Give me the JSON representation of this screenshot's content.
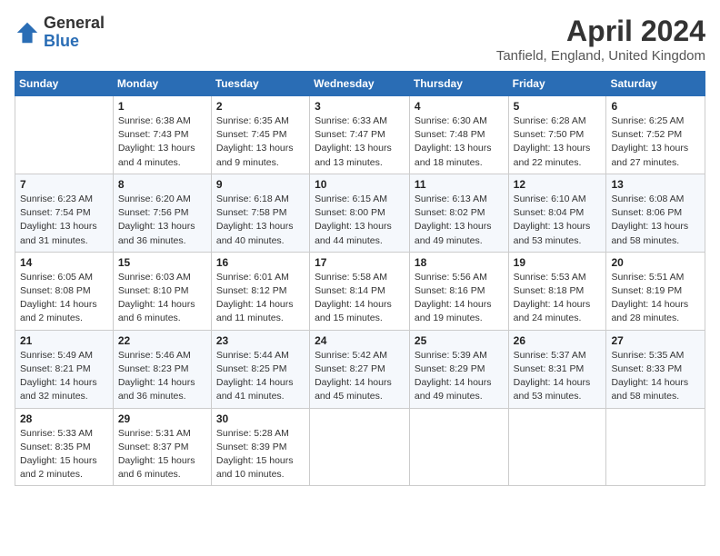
{
  "logo": {
    "general": "General",
    "blue": "Blue"
  },
  "title": "April 2024",
  "location": "Tanfield, England, United Kingdom",
  "days_of_week": [
    "Sunday",
    "Monday",
    "Tuesday",
    "Wednesday",
    "Thursday",
    "Friday",
    "Saturday"
  ],
  "weeks": [
    [
      {
        "day": "",
        "info": ""
      },
      {
        "day": "1",
        "info": "Sunrise: 6:38 AM\nSunset: 7:43 PM\nDaylight: 13 hours\nand 4 minutes."
      },
      {
        "day": "2",
        "info": "Sunrise: 6:35 AM\nSunset: 7:45 PM\nDaylight: 13 hours\nand 9 minutes."
      },
      {
        "day": "3",
        "info": "Sunrise: 6:33 AM\nSunset: 7:47 PM\nDaylight: 13 hours\nand 13 minutes."
      },
      {
        "day": "4",
        "info": "Sunrise: 6:30 AM\nSunset: 7:48 PM\nDaylight: 13 hours\nand 18 minutes."
      },
      {
        "day": "5",
        "info": "Sunrise: 6:28 AM\nSunset: 7:50 PM\nDaylight: 13 hours\nand 22 minutes."
      },
      {
        "day": "6",
        "info": "Sunrise: 6:25 AM\nSunset: 7:52 PM\nDaylight: 13 hours\nand 27 minutes."
      }
    ],
    [
      {
        "day": "7",
        "info": "Sunrise: 6:23 AM\nSunset: 7:54 PM\nDaylight: 13 hours\nand 31 minutes."
      },
      {
        "day": "8",
        "info": "Sunrise: 6:20 AM\nSunset: 7:56 PM\nDaylight: 13 hours\nand 36 minutes."
      },
      {
        "day": "9",
        "info": "Sunrise: 6:18 AM\nSunset: 7:58 PM\nDaylight: 13 hours\nand 40 minutes."
      },
      {
        "day": "10",
        "info": "Sunrise: 6:15 AM\nSunset: 8:00 PM\nDaylight: 13 hours\nand 44 minutes."
      },
      {
        "day": "11",
        "info": "Sunrise: 6:13 AM\nSunset: 8:02 PM\nDaylight: 13 hours\nand 49 minutes."
      },
      {
        "day": "12",
        "info": "Sunrise: 6:10 AM\nSunset: 8:04 PM\nDaylight: 13 hours\nand 53 minutes."
      },
      {
        "day": "13",
        "info": "Sunrise: 6:08 AM\nSunset: 8:06 PM\nDaylight: 13 hours\nand 58 minutes."
      }
    ],
    [
      {
        "day": "14",
        "info": "Sunrise: 6:05 AM\nSunset: 8:08 PM\nDaylight: 14 hours\nand 2 minutes."
      },
      {
        "day": "15",
        "info": "Sunrise: 6:03 AM\nSunset: 8:10 PM\nDaylight: 14 hours\nand 6 minutes."
      },
      {
        "day": "16",
        "info": "Sunrise: 6:01 AM\nSunset: 8:12 PM\nDaylight: 14 hours\nand 11 minutes."
      },
      {
        "day": "17",
        "info": "Sunrise: 5:58 AM\nSunset: 8:14 PM\nDaylight: 14 hours\nand 15 minutes."
      },
      {
        "day": "18",
        "info": "Sunrise: 5:56 AM\nSunset: 8:16 PM\nDaylight: 14 hours\nand 19 minutes."
      },
      {
        "day": "19",
        "info": "Sunrise: 5:53 AM\nSunset: 8:18 PM\nDaylight: 14 hours\nand 24 minutes."
      },
      {
        "day": "20",
        "info": "Sunrise: 5:51 AM\nSunset: 8:19 PM\nDaylight: 14 hours\nand 28 minutes."
      }
    ],
    [
      {
        "day": "21",
        "info": "Sunrise: 5:49 AM\nSunset: 8:21 PM\nDaylight: 14 hours\nand 32 minutes."
      },
      {
        "day": "22",
        "info": "Sunrise: 5:46 AM\nSunset: 8:23 PM\nDaylight: 14 hours\nand 36 minutes."
      },
      {
        "day": "23",
        "info": "Sunrise: 5:44 AM\nSunset: 8:25 PM\nDaylight: 14 hours\nand 41 minutes."
      },
      {
        "day": "24",
        "info": "Sunrise: 5:42 AM\nSunset: 8:27 PM\nDaylight: 14 hours\nand 45 minutes."
      },
      {
        "day": "25",
        "info": "Sunrise: 5:39 AM\nSunset: 8:29 PM\nDaylight: 14 hours\nand 49 minutes."
      },
      {
        "day": "26",
        "info": "Sunrise: 5:37 AM\nSunset: 8:31 PM\nDaylight: 14 hours\nand 53 minutes."
      },
      {
        "day": "27",
        "info": "Sunrise: 5:35 AM\nSunset: 8:33 PM\nDaylight: 14 hours\nand 58 minutes."
      }
    ],
    [
      {
        "day": "28",
        "info": "Sunrise: 5:33 AM\nSunset: 8:35 PM\nDaylight: 15 hours\nand 2 minutes."
      },
      {
        "day": "29",
        "info": "Sunrise: 5:31 AM\nSunset: 8:37 PM\nDaylight: 15 hours\nand 6 minutes."
      },
      {
        "day": "30",
        "info": "Sunrise: 5:28 AM\nSunset: 8:39 PM\nDaylight: 15 hours\nand 10 minutes."
      },
      {
        "day": "",
        "info": ""
      },
      {
        "day": "",
        "info": ""
      },
      {
        "day": "",
        "info": ""
      },
      {
        "day": "",
        "info": ""
      }
    ]
  ]
}
